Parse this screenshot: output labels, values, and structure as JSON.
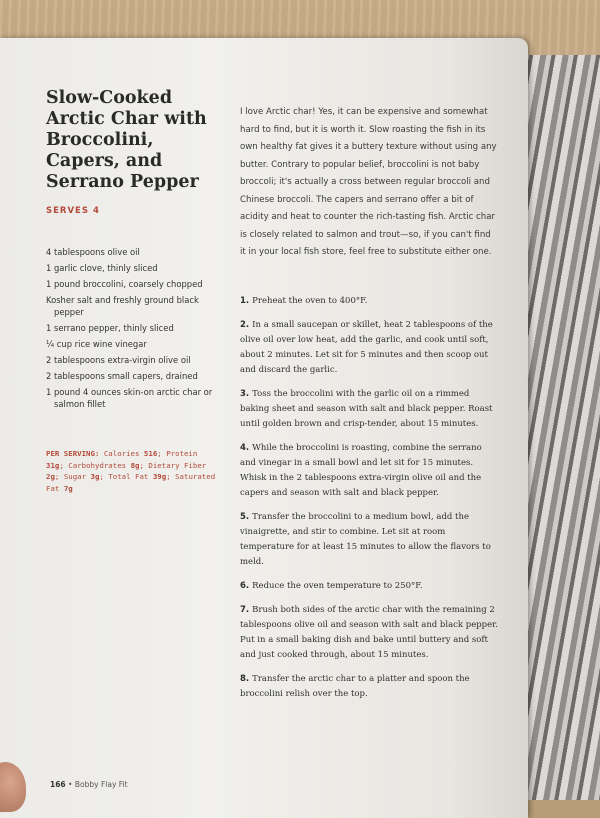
{
  "recipe": {
    "title": "Slow-Cooked Arctic Char with Broccolini, Capers, and Serrano Pepper",
    "serves": "SERVES 4",
    "ingredients": [
      "4 tablespoons olive oil",
      "1 garlic clove, thinly sliced",
      "1 pound broccolini, coarsely chopped",
      "Kosher salt and freshly ground black pepper",
      "1 serrano pepper, thinly sliced",
      "¼ cup rice wine vinegar",
      "2 tablespoons extra-virgin olive oil",
      "2 tablespoons small capers, drained",
      "1 pound 4 ounces skin-on arctic char or salmon fillet"
    ],
    "nutrition": {
      "heading": "PER SERVING:",
      "calories_label": "Calories",
      "calories": "516",
      "protein_label": "Protein",
      "protein": "31g",
      "carbs_label": "Carbohydrates",
      "carbs": "8g",
      "fiber_label": "Dietary Fiber",
      "fiber": "2g",
      "sugar_label": "Sugar",
      "sugar": "3g",
      "fat_label": "Total Fat",
      "fat": "39g",
      "satfat_label": "Saturated Fat",
      "satfat": "7g"
    },
    "intro": "I love Arctic char! Yes, it can be expensive and somewhat hard to find, but it is worth it. Slow roasting the fish in its own healthy fat gives it a buttery texture without using any butter. Contrary to popular belief, broccolini is not baby broccoli; it's actually a cross between regular broccoli and Chinese broccoli. The capers and serrano offer a bit of acidity and heat to counter the rich-tasting fish. Arctic char is closely related to salmon and trout—so, if you can't find it in your local fish store, feel free to substitute either one.",
    "steps": [
      {
        "num": "1.",
        "text": "Preheat the oven to 400°F."
      },
      {
        "num": "2.",
        "text": "In a small saucepan or skillet, heat 2 tablespoons of the olive oil over low heat, add the garlic, and cook until soft, about 2 minutes. Let sit for 5 minutes and then scoop out and discard the garlic."
      },
      {
        "num": "3.",
        "text": "Toss the broccolini with the garlic oil on a rimmed baking sheet and season with salt and black pepper. Roast until golden brown and crisp-tender, about 15 minutes."
      },
      {
        "num": "4.",
        "text": "While the broccolini is roasting, combine the serrano and vinegar in a small bowl and let sit for 15 minutes. Whisk in the 2 tablespoons extra-virgin olive oil and the capers and season with salt and black pepper."
      },
      {
        "num": "5.",
        "text": "Transfer the broccolini to a medium bowl, add the vinaigrette, and stir to combine. Let sit at room temperature for at least 15 minutes to allow the flavors to meld."
      },
      {
        "num": "6.",
        "text": "Reduce the oven temperature to 250°F."
      },
      {
        "num": "7.",
        "text": "Brush both sides of the arctic char with the remaining 2 tablespoons olive oil and season with salt and black pepper. Put in a small baking dish and bake until buttery and soft and just cooked through, about 15 minutes."
      },
      {
        "num": "8.",
        "text": "Transfer the arctic char to a platter and spoon the broccolini relish over the top."
      }
    ]
  },
  "footer": {
    "page_number": "166",
    "separator": "•",
    "book_title": "Bobby Flay Fit"
  },
  "colors": {
    "accent": "#b34a3a",
    "page": "#efeeea"
  }
}
